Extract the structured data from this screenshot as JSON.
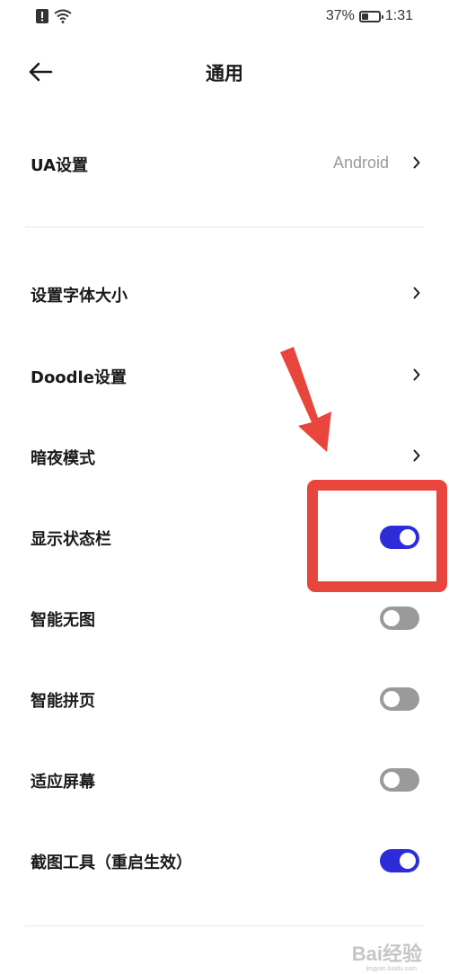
{
  "status_bar": {
    "battery_percent": "37%",
    "battery_level": 0.37,
    "time": "1:31"
  },
  "header": {
    "title": "通用",
    "back_icon": "arrow-left-icon"
  },
  "settings": {
    "ua": {
      "label": "UA设置",
      "value": "Android"
    },
    "font_size": {
      "label": "设置字体大小"
    },
    "doodle": {
      "label": "Doodle设置"
    },
    "dark_mode": {
      "label": "暗夜模式"
    },
    "status_bar_toggle": {
      "label": "显示状态栏",
      "on": true
    },
    "smart_no_image": {
      "label": "智能无图",
      "on": false
    },
    "smart_paging": {
      "label": "智能拼页",
      "on": false
    },
    "fit_screen": {
      "label": "适应屏幕",
      "on": false
    },
    "screenshot_tool": {
      "label": "截图工具（重启生效）",
      "on": true
    }
  },
  "colors": {
    "toggle_on": "#2c2cd8",
    "toggle_off": "#9a9a9a",
    "annotation": "#e8453c"
  },
  "watermark": {
    "brand": "Bai经验",
    "url": "jingyan.baidu.com"
  }
}
